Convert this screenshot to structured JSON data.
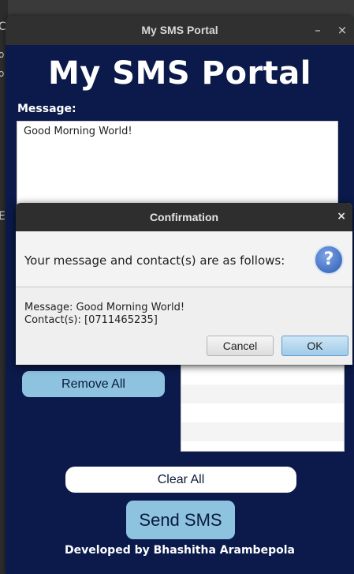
{
  "window": {
    "title": "My SMS Portal",
    "minimize_glyph": "–",
    "close_glyph": "×"
  },
  "app": {
    "heading": "My SMS Portal",
    "message_label": "Message:",
    "message_value": "Good Morning World!",
    "remove_all_label": "Remove All",
    "clear_all_label": "Clear All",
    "send_label": "Send SMS",
    "footer": "Developed by Bhashitha Arambepola"
  },
  "dialog": {
    "title": "Confirmation",
    "close_glyph": "×",
    "header_text": "Your message and contact(s) are as follows:",
    "icon": "question-icon",
    "icon_glyph": "?",
    "message_line": "Message: Good Morning World!",
    "contacts_line": "Contact(s): [0711465235]",
    "cancel_label": "Cancel",
    "ok_label": "OK"
  },
  "colors": {
    "app_background": "#0b1a4a",
    "button_blue": "#8ec3e0",
    "titlebar": "#303030"
  }
}
